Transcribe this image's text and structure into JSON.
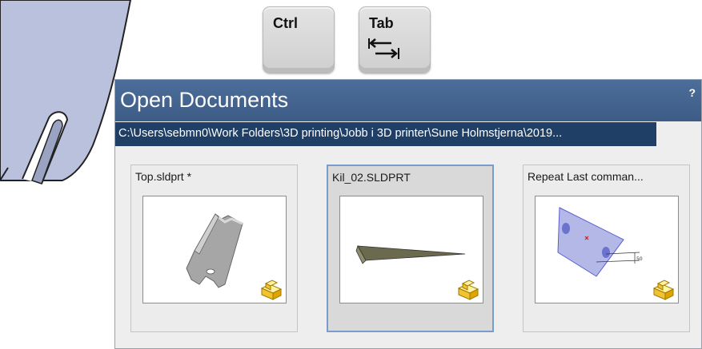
{
  "keys": {
    "ctrl": "Ctrl",
    "tab": "Tab"
  },
  "dialog": {
    "title": "Open Documents",
    "help": "?",
    "path": "C:\\Users\\sebmn0\\Work Folders\\3D printing\\Jobb i 3D printer\\Sune Holmstjerna\\2019...",
    "documents": [
      {
        "label": "Top.sldprt *",
        "icon": "part-icon",
        "selected": false
      },
      {
        "label": "Kil_02.SLDPRT",
        "icon": "part-icon",
        "selected": true
      },
      {
        "label": "Repeat Last comman...",
        "icon": "part-icon",
        "selected": false
      }
    ]
  },
  "colors": {
    "title_bar": "#3f608b",
    "path_bar": "#1f3f66",
    "selection_border": "#7a9ccc",
    "part_background": "#b9c1dd"
  }
}
